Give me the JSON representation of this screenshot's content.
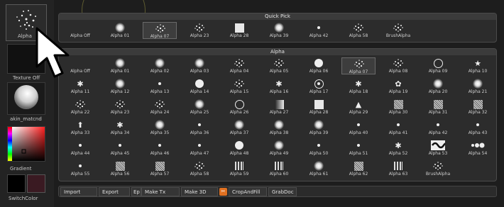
{
  "left": {
    "alpha_label": "Alpha",
    "texture_label": "Texture Off",
    "material_label": "akin_matcnd",
    "gradient_label": "Gradient",
    "switch_label": "SwitchColor",
    "color_main": "#000000",
    "color_secondary": "#3a1a22"
  },
  "quick_pick": {
    "title": "Quick Pick",
    "items": [
      {
        "label": "Alpha Off",
        "icon": "none"
      },
      {
        "label": "Alpha 01",
        "icon": "soft-dot"
      },
      {
        "label": "Alpha 07",
        "icon": "speckle",
        "selected": true
      },
      {
        "label": "Alpha 23",
        "icon": "speckle"
      },
      {
        "label": "Alpha 28",
        "icon": "square"
      },
      {
        "label": "Alpha 39",
        "icon": "soft-dot"
      },
      {
        "label": "Alpha 42",
        "icon": "small-dot"
      },
      {
        "label": "Alpha 58",
        "icon": "speckle"
      },
      {
        "label": "BrushAlpha",
        "icon": "speckle"
      }
    ]
  },
  "alpha_grid": {
    "title": "Alpha",
    "items": [
      {
        "label": "Alpha Off",
        "icon": "none"
      },
      {
        "label": "Alpha 01",
        "icon": "soft-dot"
      },
      {
        "label": "Alpha 02",
        "icon": "soft-dot"
      },
      {
        "label": "Alpha 03",
        "icon": "soft-dot"
      },
      {
        "label": "Alpha 04",
        "icon": "speckle"
      },
      {
        "label": "Alpha 05",
        "icon": "speckle"
      },
      {
        "label": "Alpha 06",
        "icon": "big-dot"
      },
      {
        "label": "Alpha 07",
        "icon": "speckle",
        "selected": true
      },
      {
        "label": "Alpha 08",
        "icon": "speckle"
      },
      {
        "label": "Alpha 09",
        "icon": "ring"
      },
      {
        "label": "Alpha 10",
        "icon": "star"
      },
      {
        "label": "Alpha 11",
        "icon": "asterisk"
      },
      {
        "label": "Alpha 12",
        "icon": "soft-dot"
      },
      {
        "label": "Alpha 13",
        "icon": "small-dot"
      },
      {
        "label": "Alpha 14",
        "icon": "big-dot"
      },
      {
        "label": "Alpha 15",
        "icon": "speckle"
      },
      {
        "label": "Alpha 16",
        "icon": "asterisk"
      },
      {
        "label": "Alpha 17",
        "icon": "target"
      },
      {
        "label": "Alpha 18",
        "icon": "asterisk"
      },
      {
        "label": "Alpha 19",
        "icon": "flower"
      },
      {
        "label": "Alpha 20",
        "icon": "soft-dot"
      },
      {
        "label": "Alpha 21",
        "icon": "soft-dot"
      },
      {
        "label": "Alpha 22",
        "icon": "speckle"
      },
      {
        "label": "Alpha 23",
        "icon": "speckle"
      },
      {
        "label": "Alpha 24",
        "icon": "speckle"
      },
      {
        "label": "Alpha 25",
        "icon": "soft-dot"
      },
      {
        "label": "Alpha 26",
        "icon": "ring"
      },
      {
        "label": "Alpha 27",
        "icon": "gradient"
      },
      {
        "label": "Alpha 28",
        "icon": "square"
      },
      {
        "label": "Alpha 29",
        "icon": "triangle"
      },
      {
        "label": "Alpha 30",
        "icon": "noise"
      },
      {
        "label": "Alpha 31",
        "icon": "noise"
      },
      {
        "label": "Alpha 32",
        "icon": "noise"
      },
      {
        "label": "Alpha 33",
        "icon": "arrow"
      },
      {
        "label": "Alpha 34",
        "icon": "asterisk"
      },
      {
        "label": "Alpha 35",
        "icon": "soft-dot"
      },
      {
        "label": "Alpha 36",
        "icon": "small-dot"
      },
      {
        "label": "Alpha 37",
        "icon": "soft-dot"
      },
      {
        "label": "Alpha 38",
        "icon": "soft-dot"
      },
      {
        "label": "Alpha 39",
        "icon": "soft-dot"
      },
      {
        "label": "Alpha 40",
        "icon": "small-dot"
      },
      {
        "label": "Alpha 41",
        "icon": "small-dot"
      },
      {
        "label": "Alpha 42",
        "icon": "small-dot"
      },
      {
        "label": "Alpha 43",
        "icon": "small-dot"
      },
      {
        "label": "Alpha 44",
        "icon": "small-dot"
      },
      {
        "label": "Alpha 45",
        "icon": "small-dot"
      },
      {
        "label": "Alpha 46",
        "icon": "small-dot"
      },
      {
        "label": "Alpha 47",
        "icon": "small-dot"
      },
      {
        "label": "Alpha 48",
        "icon": "big-dot"
      },
      {
        "label": "Alpha 49",
        "icon": "soft-dot"
      },
      {
        "label": "Alpha 50",
        "icon": "small-dot"
      },
      {
        "label": "Alpha 51",
        "icon": "small-dot"
      },
      {
        "label": "Alpha 52",
        "icon": "asterisk"
      },
      {
        "label": "Alpha 53",
        "icon": "pattern"
      },
      {
        "label": "Alpha 54",
        "icon": "dots-row"
      },
      {
        "label": "Alpha 55",
        "icon": "small-dot"
      },
      {
        "label": "Alpha 56",
        "icon": "noise"
      },
      {
        "label": "Alpha 57",
        "icon": "noise"
      },
      {
        "label": "Alpha 58",
        "icon": "speckle"
      },
      {
        "label": "Alpha 59",
        "icon": "bars"
      },
      {
        "label": "Alpha 60",
        "icon": "bars"
      },
      {
        "label": "Alpha 61",
        "icon": "soft-dot"
      },
      {
        "label": "Alpha 62",
        "icon": "noise"
      },
      {
        "label": "Alpha 63",
        "icon": "bars"
      },
      {
        "label": "BrushAlpha",
        "icon": "speckle"
      }
    ]
  },
  "bottom_bar": [
    {
      "label": "Import"
    },
    {
      "label": "Export"
    },
    {
      "label": "Ep"
    },
    {
      "label": "Make Tx"
    },
    {
      "label": "Make 3D"
    },
    {
      "label": "CropAndFill"
    },
    {
      "label": "GrabDoc"
    }
  ]
}
